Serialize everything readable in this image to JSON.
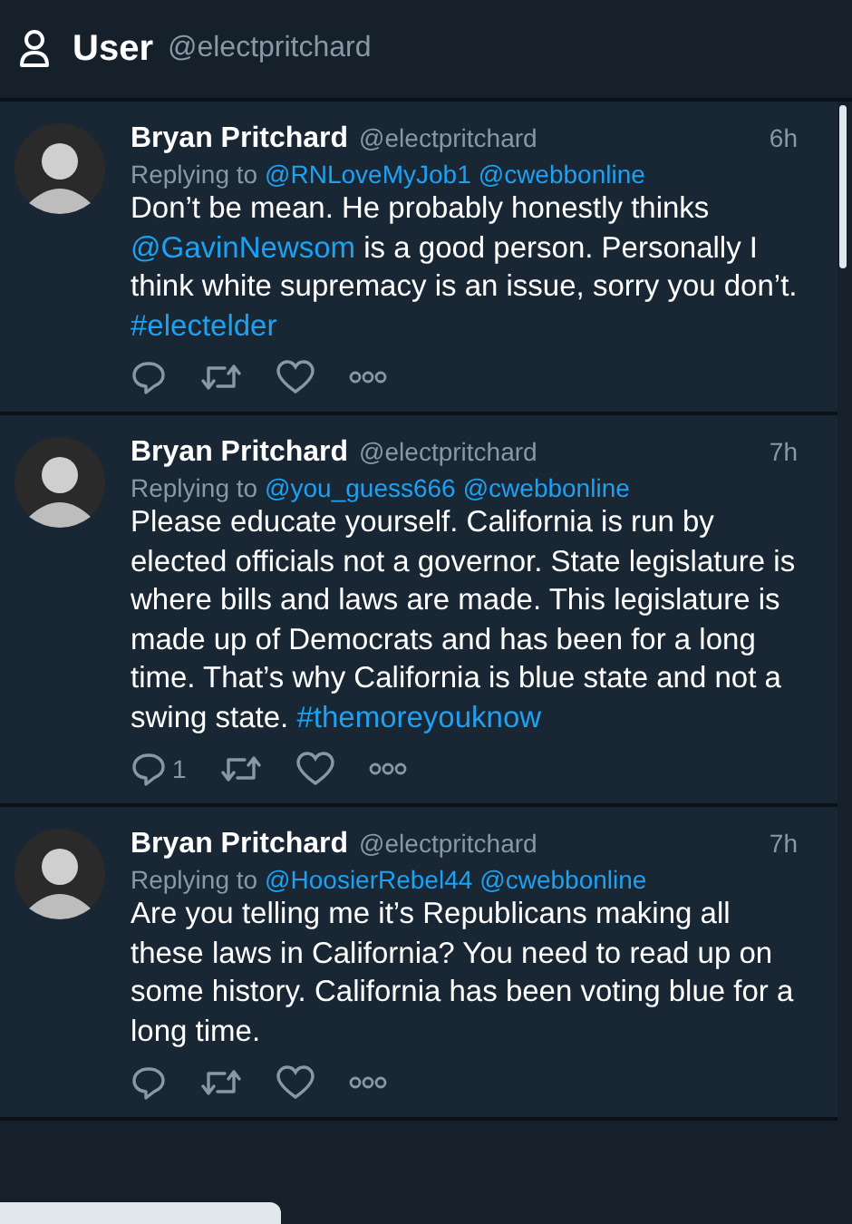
{
  "header": {
    "title": "User",
    "handle": "@electpritchard"
  },
  "tweets": [
    {
      "name": "Bryan Pritchard",
      "handle": "@electpritchard",
      "time": "6h",
      "replying_label": "Replying to",
      "replying_to": [
        "@RNLoveMyJob1",
        "@cwebbonline"
      ],
      "body": [
        {
          "kind": "text",
          "text": "Don’t be mean. He probably honestly thinks "
        },
        {
          "kind": "mention",
          "text": "@GavinNewsom"
        },
        {
          "kind": "text",
          "text": " is a good person. Personally I think white supremacy is an issue, sorry you don’t. "
        },
        {
          "kind": "hashtag",
          "text": "#electelder"
        }
      ]
    },
    {
      "name": "Bryan Pritchard",
      "handle": "@electpritchard",
      "time": "7h",
      "replying_label": "Replying to",
      "replying_to": [
        "@you_guess666",
        "@cwebbonline"
      ],
      "body": [
        {
          "kind": "text",
          "text": "Please educate yourself. California is run by elected officials not a governor. State legislature is where bills and laws are made. This legislature is made up of Democrats and has been for a long time. That’s why California is blue state and not a swing state. "
        },
        {
          "kind": "hashtag",
          "text": "#themoreyouknow"
        }
      ],
      "reply_count": "1"
    },
    {
      "name": "Bryan Pritchard",
      "handle": "@electpritchard",
      "time": "7h",
      "replying_label": "Replying to",
      "replying_to": [
        "@HoosierRebel44",
        "@cwebbonline"
      ],
      "body": [
        {
          "kind": "text",
          "text": "Are you telling me it’s Republicans making all these laws in California? You need to read up on some history. California has been voting blue for a long time."
        }
      ]
    }
  ]
}
